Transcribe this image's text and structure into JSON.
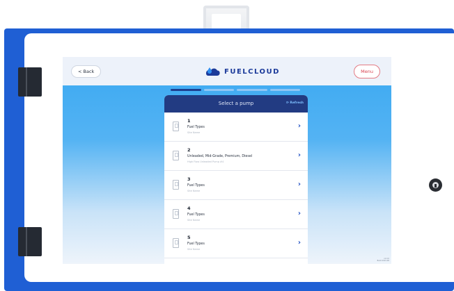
{
  "screen": {
    "back_label": "< Back",
    "brand": "FUELCLOUD",
    "menu_label": "Menu",
    "progress_steps": 4,
    "progress_active": 1
  },
  "panel": {
    "title": "Select a pump",
    "refresh_label": "⟳ Refresh"
  },
  "pumps": [
    {
      "number": "1",
      "fuel": "Fuel Types",
      "sub": "Site Name"
    },
    {
      "number": "2",
      "fuel": "Unleaded, Mid-Grade, Premium, Diesel",
      "sub": "High Flow Unleaded Pump #4"
    },
    {
      "number": "3",
      "fuel": "Fuel Types",
      "sub": "Site Name"
    },
    {
      "number": "4",
      "fuel": "Fuel Types",
      "sub": "Site Name"
    },
    {
      "number": "5",
      "fuel": "Fuel Types",
      "sub": "Site Name"
    },
    {
      "number": "6",
      "fuel": "",
      "sub": ""
    }
  ],
  "version": {
    "line1": "v1.0.0",
    "line2": "Build 2021.06"
  },
  "colors": {
    "brand_blue": "#1b3a9a",
    "header_navy": "#223b82",
    "menu_red": "#d8404f",
    "kiosk_blue": "#1f5fd4"
  }
}
